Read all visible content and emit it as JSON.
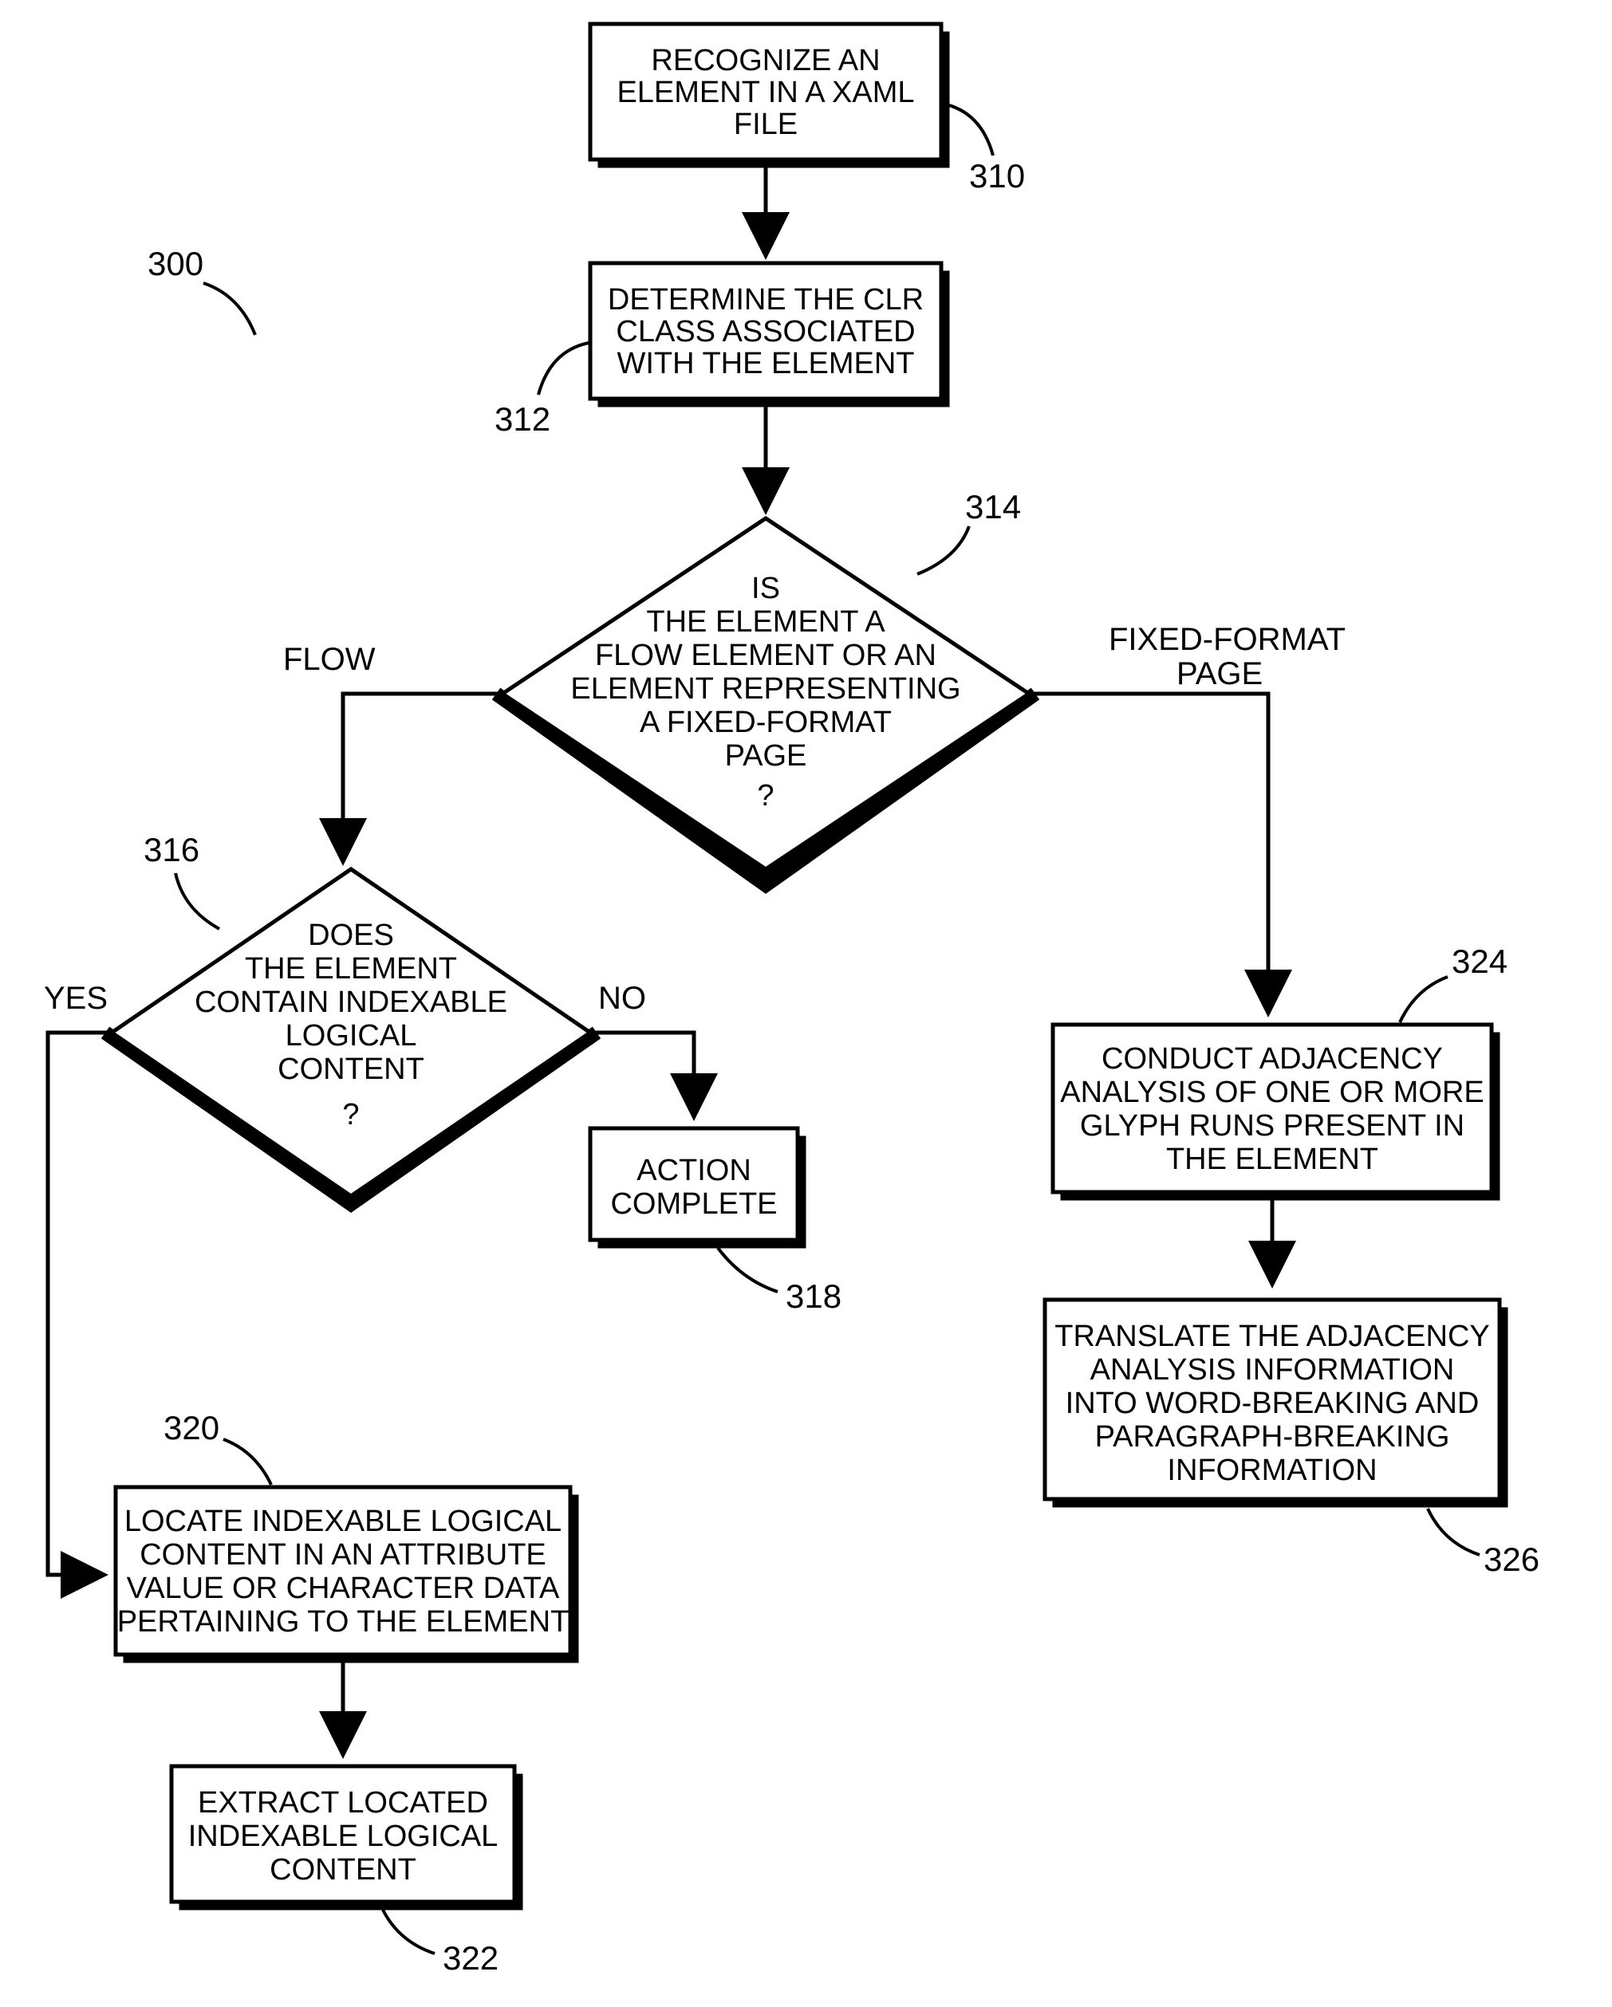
{
  "figure_ref": "300",
  "nodes": {
    "n310": {
      "ref": "310",
      "lines": [
        "RECOGNIZE AN",
        "ELEMENT IN A XAML",
        "FILE"
      ]
    },
    "n312": {
      "ref": "312",
      "lines": [
        "DETERMINE THE CLR",
        "CLASS ASSOCIATED",
        "WITH THE ELEMENT"
      ]
    },
    "n314": {
      "ref": "314",
      "lines": [
        "IS",
        "THE ELEMENT A",
        "FLOW ELEMENT OR AN",
        "ELEMENT REPRESENTING",
        "A FIXED-FORMAT",
        "PAGE",
        "?"
      ]
    },
    "n316": {
      "ref": "316",
      "lines": [
        "DOES",
        "THE ELEMENT",
        "CONTAIN INDEXABLE",
        "LOGICAL",
        "CONTENT",
        "?"
      ]
    },
    "n318": {
      "ref": "318",
      "lines": [
        "ACTION",
        "COMPLETE"
      ]
    },
    "n320": {
      "ref": "320",
      "lines": [
        "LOCATE INDEXABLE LOGICAL",
        "CONTENT IN AN ATTRIBUTE",
        "VALUE OR CHARACTER DATA",
        "PERTAINING TO THE ELEMENT"
      ]
    },
    "n322": {
      "ref": "322",
      "lines": [
        "EXTRACT LOCATED",
        "INDEXABLE LOGICAL",
        "CONTENT"
      ]
    },
    "n324": {
      "ref": "324",
      "lines": [
        "CONDUCT ADJACENCY",
        "ANALYSIS OF ONE OR MORE",
        "GLYPH RUNS PRESENT IN",
        "THE ELEMENT"
      ]
    },
    "n326": {
      "ref": "326",
      "lines": [
        "TRANSLATE THE ADJACENCY",
        "ANALYSIS INFORMATION",
        "INTO WORD-BREAKING AND",
        "PARAGRAPH-BREAKING",
        "INFORMATION"
      ]
    }
  },
  "edge_labels": {
    "flow": "FLOW",
    "fixed": [
      "FIXED-FORMAT",
      "PAGE"
    ],
    "yes": "YES",
    "no": "NO"
  }
}
